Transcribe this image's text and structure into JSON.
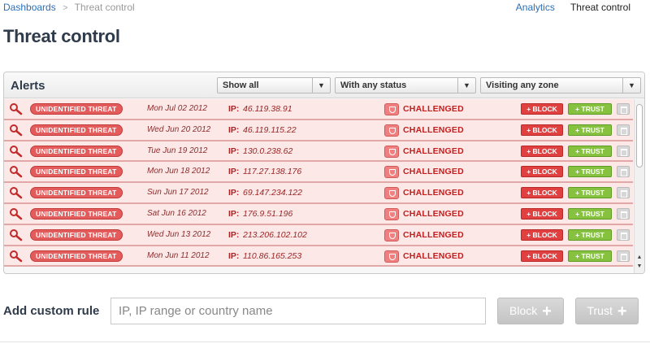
{
  "breadcrumb": {
    "root": "Dashboards",
    "separator": ">",
    "current": "Threat control"
  },
  "topnav": {
    "analytics": "Analytics",
    "threat_control": "Threat control"
  },
  "page": {
    "title": "Threat control"
  },
  "alerts": {
    "title": "Alerts",
    "filters": {
      "show": "Show all",
      "status": "With any status",
      "zone": "Visiting any zone"
    },
    "rows": [
      {
        "badge": "Unidentified threat",
        "date": "Mon Jul 02 2012",
        "ip_label": "IP:",
        "ip": "46.119.38.91",
        "status": "CHALLENGED",
        "block": "+ BLOCK",
        "trust": "+ TRUST"
      },
      {
        "badge": "Unidentified threat",
        "date": "Wed Jun 20 2012",
        "ip_label": "IP:",
        "ip": "46.119.115.22",
        "status": "CHALLENGED",
        "block": "+ BLOCK",
        "trust": "+ TRUST"
      },
      {
        "badge": "Unidentified threat",
        "date": "Tue Jun 19 2012",
        "ip_label": "IP:",
        "ip": "130.0.238.62",
        "status": "CHALLENGED",
        "block": "+ BLOCK",
        "trust": "+ TRUST"
      },
      {
        "badge": "Unidentified threat",
        "date": "Mon Jun 18 2012",
        "ip_label": "IP:",
        "ip": "117.27.138.176",
        "status": "CHALLENGED",
        "block": "+ BLOCK",
        "trust": "+ TRUST"
      },
      {
        "badge": "Unidentified threat",
        "date": "Sun Jun 17 2012",
        "ip_label": "IP:",
        "ip": "69.147.234.122",
        "status": "CHALLENGED",
        "block": "+ BLOCK",
        "trust": "+ TRUST"
      },
      {
        "badge": "Unidentified threat",
        "date": "Sat Jun 16 2012",
        "ip_label": "IP:",
        "ip": "176.9.51.196",
        "status": "CHALLENGED",
        "block": "+ BLOCK",
        "trust": "+ TRUST"
      },
      {
        "badge": "Unidentified threat",
        "date": "Wed Jun 13 2012",
        "ip_label": "IP:",
        "ip": "213.206.102.102",
        "status": "CHALLENGED",
        "block": "+ BLOCK",
        "trust": "+ TRUST"
      },
      {
        "badge": "Unidentified threat",
        "date": "Mon Jun 11 2012",
        "ip_label": "IP:",
        "ip": "110.86.165.253",
        "status": "CHALLENGED",
        "block": "+ BLOCK",
        "trust": "+ TRUST"
      }
    ]
  },
  "custom_rule": {
    "label": "Add custom rule",
    "placeholder": "IP, IP range or country name",
    "block_label": "Block",
    "trust_label": "Trust",
    "plus": "+"
  },
  "colors": {
    "accent_link": "#2a6fb8",
    "threat_red": "#e35b5b",
    "row_bg": "#fde8e8",
    "trust_green": "#86c23f"
  },
  "icons": {
    "row_search": "magnifier-icon",
    "row_status": "shield-icon",
    "row_delete": "trash-icon"
  }
}
